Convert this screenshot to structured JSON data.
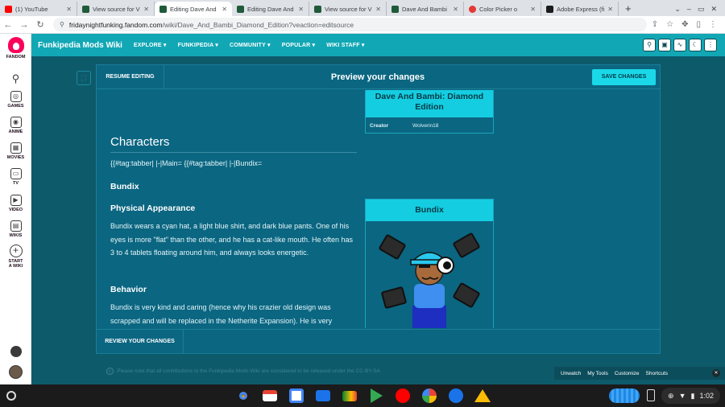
{
  "browser": {
    "tabs": [
      {
        "title": "(1) YouTube",
        "favicon_color": "#ff0000",
        "active": false
      },
      {
        "title": "View source for V",
        "favicon_color": "#1f5b3a",
        "active": false
      },
      {
        "title": "Editing Dave And",
        "favicon_color": "#1f5b3a",
        "active": true
      },
      {
        "title": "Editing Dave And",
        "favicon_color": "#1f5b3a",
        "active": false
      },
      {
        "title": "View source for V",
        "favicon_color": "#1f5b3a",
        "active": false
      },
      {
        "title": "Dave And Bambi",
        "favicon_color": "#1f5b3a",
        "active": false
      },
      {
        "title": "Color Picker o",
        "favicon_color": "#e53935",
        "active": false
      },
      {
        "title": "Adobe Express (fi",
        "favicon_color": "#1b1b1b",
        "active": false
      }
    ],
    "new_tab": "+",
    "url_domain": "fridaynightfunking.fandom.com",
    "url_path": "/wiki/Dave_And_Bambi_Diamond_Edition?veaction=editsource"
  },
  "rail": {
    "brand": "FANDOM",
    "items": [
      "GAMES",
      "ANIME",
      "MOVIES",
      "TV",
      "VIDEO",
      "WIKIS",
      "START A WIKI"
    ]
  },
  "wiki": {
    "name": "Funkipedia Mods Wiki",
    "nav": [
      "EXPLORE ▾",
      "FUNKIPEDIA ▾",
      "COMMUNITY ▾",
      "POPULAR ▾",
      "WIKI STAFF ▾"
    ]
  },
  "dialog": {
    "resume_label": "RESUME EDITING",
    "title": "Preview your changes",
    "save_label": "SAVE CHANGES",
    "review_label": "REVIEW YOUR CHANGES"
  },
  "content": {
    "infobox1": {
      "title": "Dave And Bambi: Diamond Edition",
      "creator_key": "Creator",
      "creator_value": "Wolverin18"
    },
    "heading": "Characters",
    "tabber_text": "{{#tag:tabber| |-|Main= {{#tag:tabber| |-|Bundix=",
    "subheading": "Bundix",
    "section1_title": "Physical Appearance",
    "section1_text": "Bundix wears a cyan hat, a light blue shirt, and dark blue pants. One of his eyes is more \"flat\" than the other, and he has a cat-like mouth. He often has 3 to 4 tablets floating around him, and always looks energetic.",
    "section2_title": "Behavior",
    "section2_text": "Bundix is very kind and caring (hence why his crazier old design was scrapped and will be replaced in the Netherite Expansion). He is very",
    "infobox2": {
      "title": "Bundix"
    }
  },
  "footer": {
    "license": "Please note that all contributions to the Funkipedia Mods Wiki are considered to be released under the CC-BY-SA",
    "wikibar": [
      "Unwatch",
      "My Tools",
      "Customize",
      "Shortcuts"
    ]
  },
  "shelf": {
    "time": "1:02"
  },
  "colors": {
    "teal": "#12a7b5",
    "dialog": "#0b6681",
    "accent": "#15cde0"
  }
}
